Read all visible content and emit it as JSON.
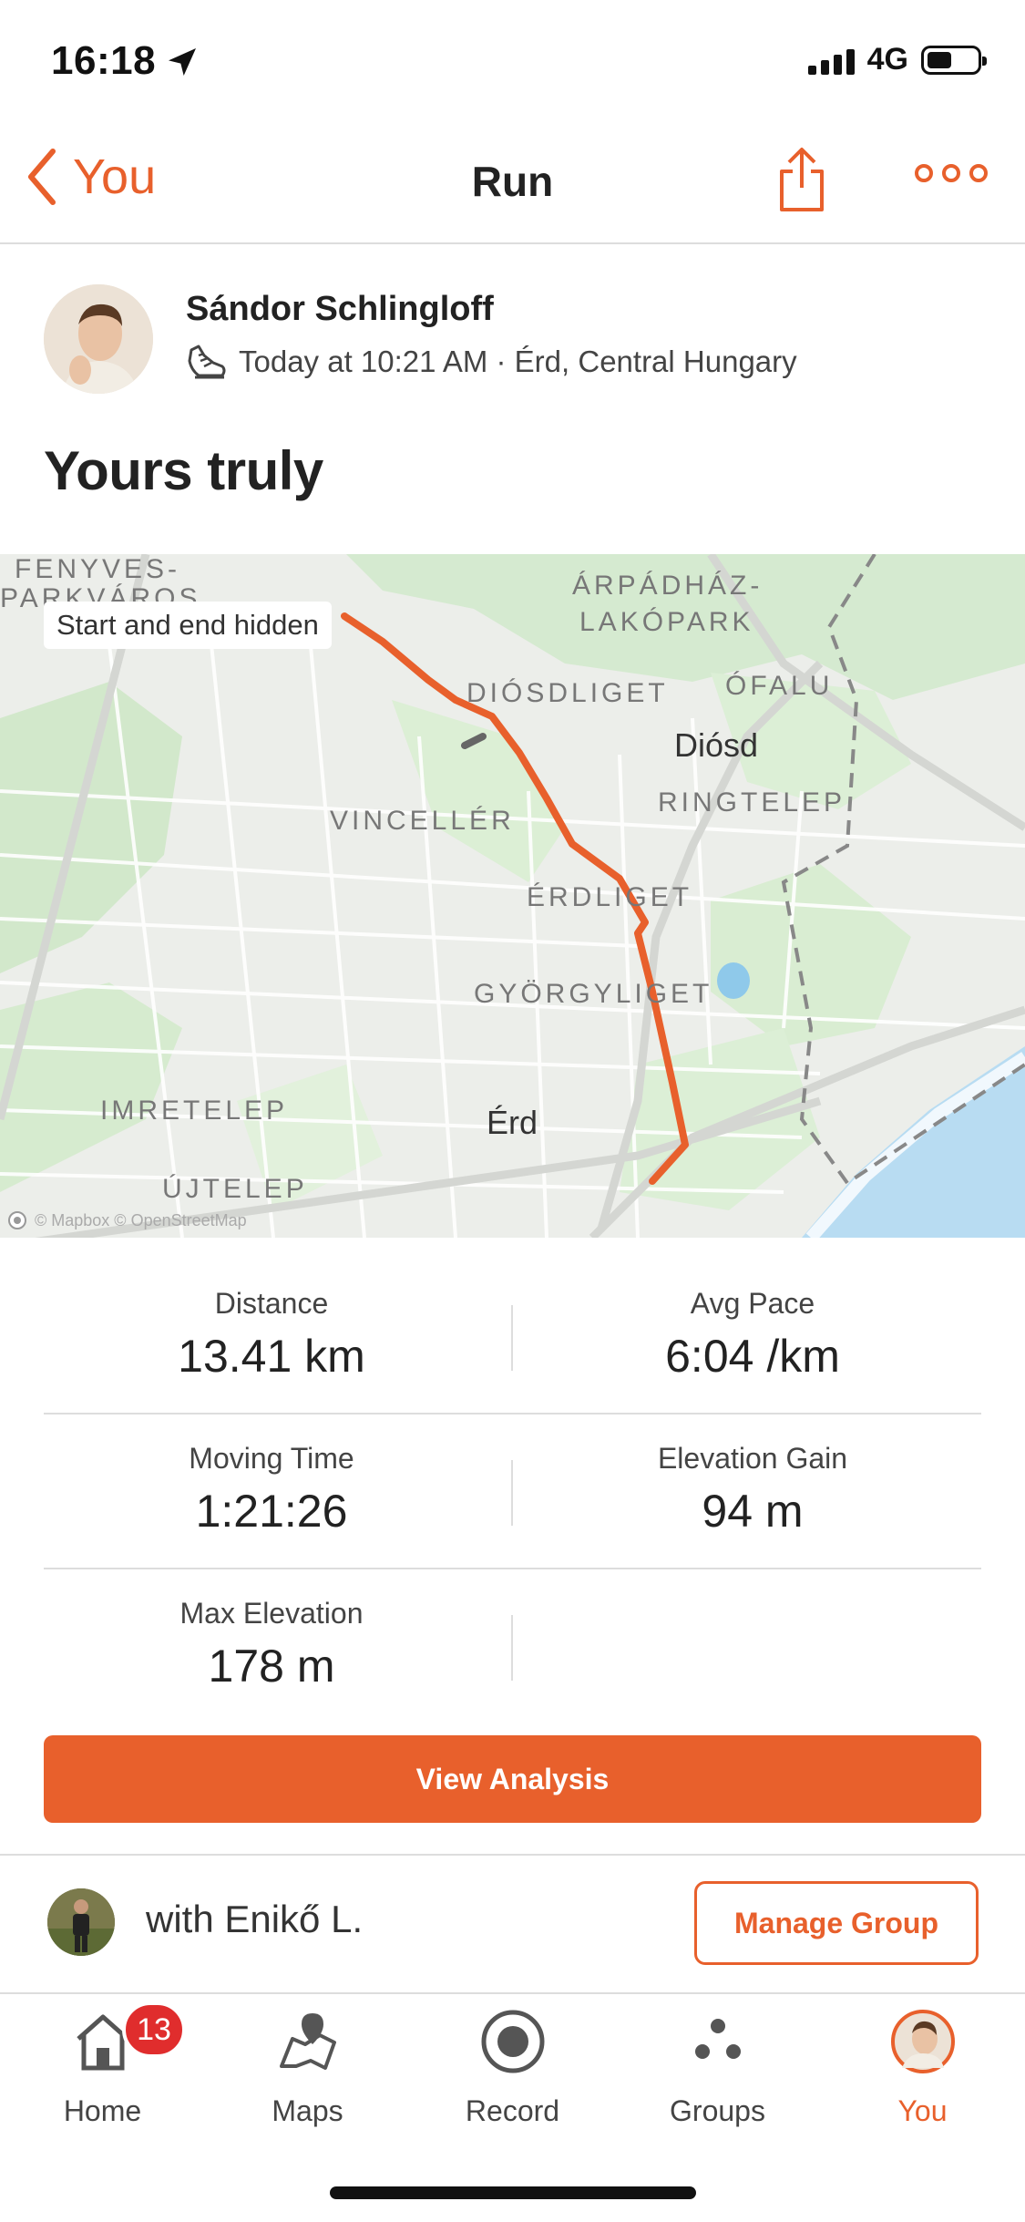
{
  "status_bar": {
    "time": "16:18",
    "network": "4G"
  },
  "header": {
    "back_label": "You",
    "title": "Run"
  },
  "athlete": {
    "name": "Sándor Schlingloff",
    "meta": "Today at 10:21 AM · Érd, Central Hungary"
  },
  "activity": {
    "title": "Yours truly"
  },
  "map": {
    "privacy_badge": "Start and end hidden",
    "attribution": "© Mapbox © OpenStreetMap",
    "labels": {
      "fenyves": "FENYVES-",
      "parkvaros": "PARKVÁROS",
      "arpadhaz": "ÁRPÁDHÁZ-",
      "lakopark": "LAKÓPARK",
      "diosdliget": "DIÓSDLIGET",
      "ofalu": "ÓFALU",
      "diosd": "Diósd",
      "ringtelep": "RINGTELEP",
      "vinceller": "VINCELLÉR",
      "erdliget": "ÉRDLIGET",
      "gyorgyliget": "GYÖRGYLIGET",
      "imretelep": "IMRETELEP",
      "erd": "Érd",
      "ujtelep": "ÚJTELEP"
    },
    "route_color": "#e8602c"
  },
  "stats": {
    "distance": {
      "label": "Distance",
      "value": "13.41 km"
    },
    "avg_pace": {
      "label": "Avg Pace",
      "value": "6:04 /km"
    },
    "moving_time": {
      "label": "Moving Time",
      "value": "1:21:26"
    },
    "elevation_gain": {
      "label": "Elevation Gain",
      "value": "94 m"
    },
    "max_elevation": {
      "label": "Max Elevation",
      "value": "178 m"
    }
  },
  "actions": {
    "view_analysis": "View Analysis"
  },
  "group": {
    "with_text": "with Enikő L.",
    "manage_label": "Manage Group"
  },
  "tabs": [
    {
      "label": "Home",
      "icon": "home-icon",
      "badge": "13"
    },
    {
      "label": "Maps",
      "icon": "map-pin-icon"
    },
    {
      "label": "Record",
      "icon": "record-icon"
    },
    {
      "label": "Groups",
      "icon": "groups-icon"
    },
    {
      "label": "You",
      "icon": "profile-avatar-icon",
      "active": true
    }
  ],
  "colors": {
    "accent": "#e8602c",
    "badge": "#e02d2d",
    "water": "#b8dcf2",
    "park": "#cfe6c4"
  }
}
